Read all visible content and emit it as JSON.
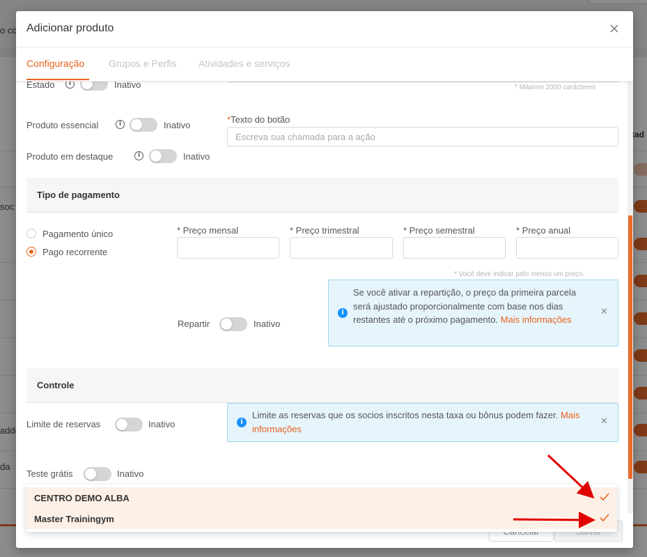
{
  "background": {
    "left_fragments": [
      "o co",
      "soc",
      "addo",
      "da"
    ],
    "right_header": "tad"
  },
  "modal": {
    "title": "Adicionar produto",
    "tabs": [
      {
        "label": "Configuração",
        "active": true
      },
      {
        "label": "Grupos e Perfis",
        "active": false
      },
      {
        "label": "Atividades e serviços",
        "active": false
      }
    ],
    "config": {
      "estado": {
        "label": "Estado",
        "state": "Inativo"
      },
      "char_limit_hint": "* Máximo 2000 carácteres",
      "produto_essencial": {
        "label": "Produto essencial",
        "state": "Inativo"
      },
      "produto_destaque": {
        "label": "Produto em destaque",
        "state": "Inativo"
      },
      "button_text": {
        "label": "Texto do botão",
        "required_mark": "*",
        "placeholder": "Escreva sua chamada para a ação"
      }
    },
    "payment": {
      "section_title": "Tipo de pagamento",
      "options": [
        {
          "label": "Pagamento único",
          "selected": false
        },
        {
          "label": "Pago recorrente",
          "selected": true
        }
      ],
      "price_fields": [
        {
          "label": "* Preço mensal",
          "value": ""
        },
        {
          "label": "* Preço trimestral",
          "value": ""
        },
        {
          "label": "* Preço semestral",
          "value": ""
        },
        {
          "label": "* Preço anual",
          "value": ""
        }
      ],
      "price_hint": "* Você deve indicar pelo menos um preço.",
      "repartir": {
        "label": "Repartir",
        "state": "Inativo"
      },
      "alert": {
        "text": "Se você ativar a repartição, o preço da primeira parcela será ajustado proporcionalmente com base nos dias restantes até o próximo pagamento.",
        "link": "Mais informações"
      }
    },
    "control": {
      "section_title": "Controle",
      "limite_reservas": {
        "label": "Limite de reservas",
        "state": "Inativo"
      },
      "alert": {
        "text": "Limite as reservas que os socios inscritos nesta taxa ou bônus podem fazer.",
        "link": "Mais informações"
      },
      "teste_gratis": {
        "label": "Teste grátis",
        "state": "Inativo"
      }
    },
    "footer": {
      "cancel_label": "Cancelar",
      "save_label": "Salvar"
    }
  },
  "dropdown": {
    "items": [
      {
        "label": "CENTRO DEMO ALBA",
        "selected": true
      },
      {
        "label": "Master Trainingym",
        "selected": true
      }
    ]
  },
  "colors": {
    "accent": "#e8631e",
    "info_bg": "#e6f4fb",
    "info_border": "#9fd5ef",
    "info_icon": "#1890ff",
    "annotation_arrow": "#e00000"
  }
}
